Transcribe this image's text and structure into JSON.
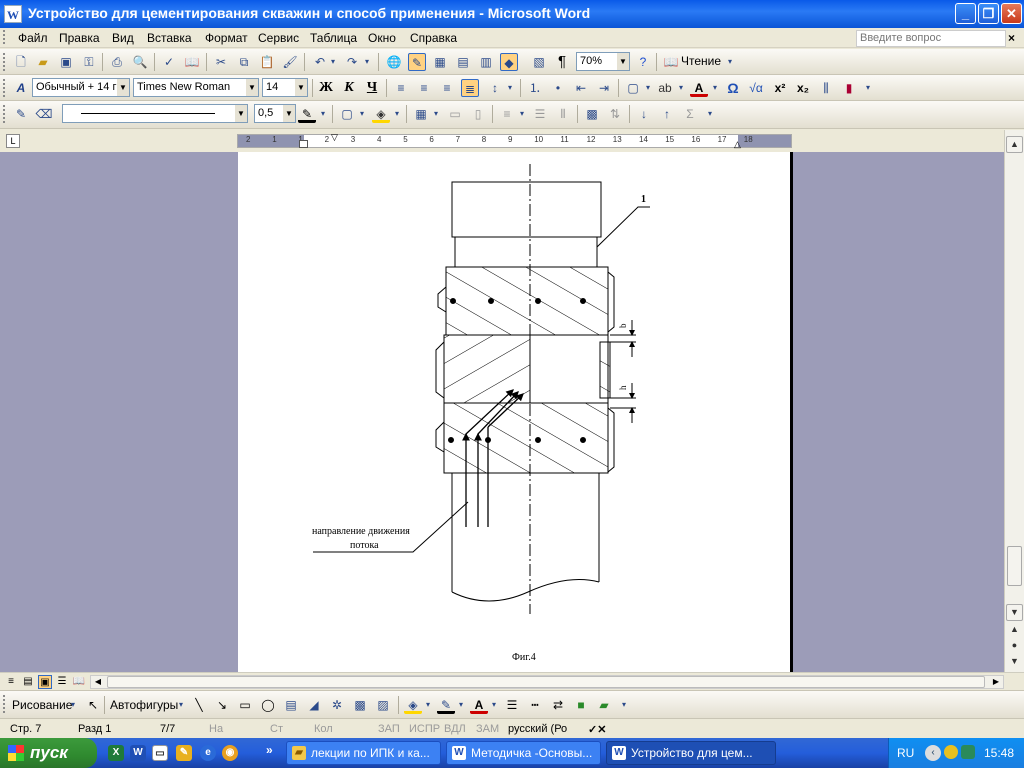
{
  "window": {
    "title": "Устройство для цементирования скважин и способ применения - Microsoft Word",
    "minimize": "_",
    "restore": "❐",
    "close": "✕"
  },
  "menu": {
    "items": [
      "Файл",
      "Правка",
      "Вид",
      "Вставка",
      "Формат",
      "Сервис",
      "Таблица",
      "Окно",
      "Справка"
    ],
    "help_placeholder": "Введите вопрос",
    "help_close": "×"
  },
  "toolbar_standard": {
    "zoom": "70%",
    "reading_label": "Чтение",
    "pilcrow": "¶"
  },
  "toolbar_formatting": {
    "style": "Обычный + 14 г",
    "font": "Times New Roman",
    "size": "14",
    "bold": "Ж",
    "italic": "К",
    "underline": "Ч",
    "font_color": "A",
    "omega": "Ω",
    "superscript": "x²",
    "subscript": "x₂"
  },
  "toolbar_tables": {
    "line_weight": "0,5",
    "sigma": "Σ"
  },
  "ruler": {
    "tab_symbol": "L",
    "labels": [
      "2",
      "1",
      "1",
      "2",
      "3",
      "4",
      "5",
      "6",
      "7",
      "8",
      "9",
      "10",
      "11",
      "12",
      "13",
      "14",
      "15",
      "16",
      "17",
      "18"
    ]
  },
  "drawing": {
    "callout_1": "1",
    "label_b": "b",
    "label_h": "h",
    "flow_line1": "направление движения",
    "flow_line2": "потока",
    "caption": "Фиг.4"
  },
  "drawbar": {
    "draw_label": "Рисование",
    "autoshapes_label": "Автофигуры"
  },
  "status": {
    "page": "Стр. 7",
    "section": "Разд 1",
    "pages": "7/7",
    "at": "На",
    "line": "Ст",
    "col": "Кол",
    "rec": "ЗАП",
    "trk": "ИСПР",
    "ext": "ВДЛ",
    "ovr": "ЗАМ",
    "lang": "русский (Ро"
  },
  "taskbar": {
    "start_label": "пуск",
    "more": "»",
    "tasks": [
      "лекции по ИПК и ка...",
      "Методичка -Основы...",
      "Устройство для цем..."
    ],
    "lang": "RU",
    "clock": "15:48"
  }
}
